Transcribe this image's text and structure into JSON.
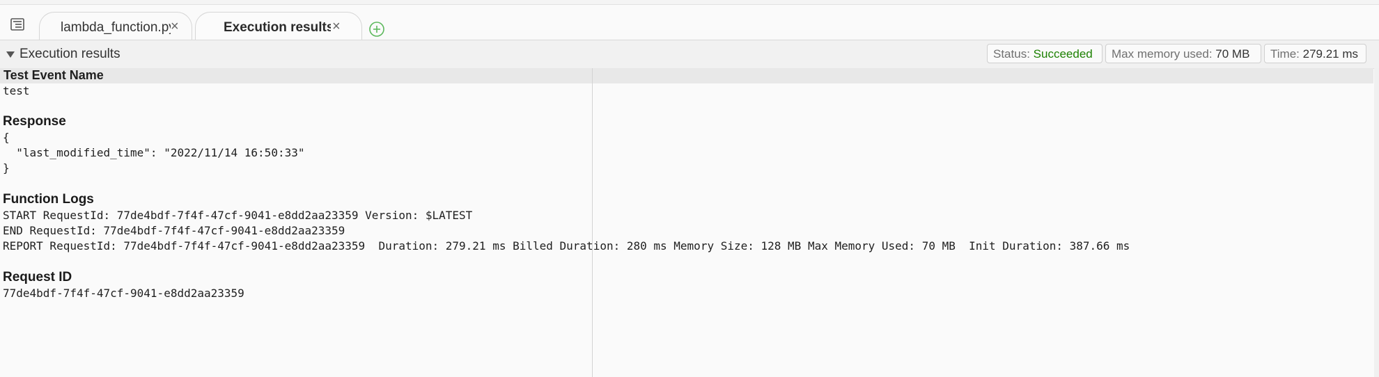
{
  "tabs": [
    {
      "label": "lambda_function.py",
      "close": "×"
    },
    {
      "label": "Execution results",
      "close": "×"
    }
  ],
  "icons": {
    "tree": "tree-icon",
    "add": "add-tab-icon",
    "caret": "caret-down-icon"
  },
  "section": {
    "title": "Execution results",
    "status_label": "Status:",
    "status_value": "Succeeded",
    "memory_label": "Max memory used:",
    "memory_value": "70 MB",
    "time_label": "Time:",
    "time_value": "279.21 ms"
  },
  "results": {
    "test_event_heading": "Test Event Name",
    "test_event_value": "test",
    "response_heading": "Response",
    "response_lines": [
      "{",
      "  \"last_modified_time\": \"2022/11/14 16:50:33\"",
      "}"
    ],
    "logs_heading": "Function Logs",
    "log_lines": [
      "START RequestId: 77de4bdf-7f4f-47cf-9041-e8dd2aa23359 Version: $LATEST",
      "END RequestId: 77de4bdf-7f4f-47cf-9041-e8dd2aa23359",
      "REPORT RequestId: 77de4bdf-7f4f-47cf-9041-e8dd2aa23359  Duration: 279.21 ms Billed Duration: 280 ms Memory Size: 128 MB Max Memory Used: 70 MB  Init Duration: 387.66 ms"
    ],
    "request_id_heading": "Request ID",
    "request_id_value": "77de4bdf-7f4f-47cf-9041-e8dd2aa23359"
  },
  "colors": {
    "success": "#1d8102",
    "add_icon": "#5cb85c"
  }
}
